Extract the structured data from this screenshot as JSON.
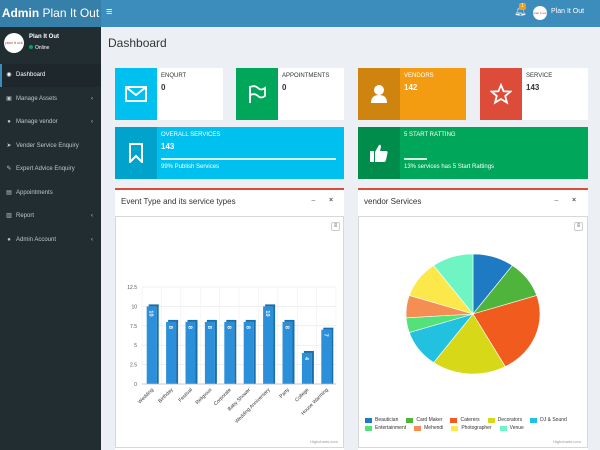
{
  "app": {
    "logo_bold": "Admin",
    "logo_rest": " Plan It Out",
    "user_name": "Plan It Out",
    "status": "Online",
    "avatar_text": "plan it out",
    "notification_count": "1"
  },
  "sidebar": {
    "items": [
      {
        "label": "Dashboard",
        "icon": "dashboard-icon",
        "glyph": "◉",
        "chevron": ""
      },
      {
        "label": "Manage Assets",
        "icon": "assets-icon",
        "glyph": "▣",
        "chevron": "‹"
      },
      {
        "label": "Manage vendor",
        "icon": "vendor-icon",
        "glyph": "●",
        "chevron": "‹"
      },
      {
        "label": "Vender Service Enquiry",
        "icon": "enquiry-icon",
        "glyph": "➤",
        "chevron": ""
      },
      {
        "label": "Expert Advice Enquiry",
        "icon": "advice-icon",
        "glyph": "✎",
        "chevron": ""
      },
      {
        "label": "Appointments",
        "icon": "appointments-icon",
        "glyph": "▤",
        "chevron": ""
      },
      {
        "label": "Report",
        "icon": "report-icon",
        "glyph": "▥",
        "chevron": "‹"
      },
      {
        "label": "Admin Account",
        "icon": "account-icon",
        "glyph": "●",
        "chevron": "‹"
      }
    ]
  },
  "page": {
    "title": "Dashboard"
  },
  "infoboxes": [
    {
      "label": "ENQURT",
      "value": "0",
      "color": "#00c0ef",
      "icon": "envelope-icon"
    },
    {
      "label": "APPOINTMENTS",
      "value": "0",
      "color": "#00a65a",
      "icon": "flag-icon"
    },
    {
      "label": "VENDORS",
      "value": "142",
      "color": "#f39c12",
      "icon": "user-icon"
    },
    {
      "label": "SERVICE",
      "value": "143",
      "color": "#dd4b39",
      "icon": "star-icon"
    }
  ],
  "progress_boxes": [
    {
      "label": "OVERALL SERVICES",
      "value": "143",
      "desc": "99% Publish Services",
      "color": "#00c0ef",
      "progress": 0.99,
      "icon": "bookmark-icon"
    },
    {
      "label": "5 START RATTING",
      "value": "",
      "desc": "13% services has 5 Start Rattings",
      "color": "#00a65a",
      "progress": 0.13,
      "icon": "thumbs-up-icon"
    }
  ],
  "boxes": {
    "event_title": "Event Type and its service types",
    "vendor_title": "vendor Services",
    "min": "−",
    "close": "×"
  },
  "credit": "Highcharts.com",
  "chart_data": [
    {
      "type": "bar",
      "categories": [
        "Wedding",
        "Birthday",
        "Festival",
        "Religious",
        "Corporate",
        "Baby Shower",
        "Wedding Anniversary",
        "Party",
        "College",
        "House Warming"
      ],
      "values": [
        10,
        8,
        8,
        8,
        8,
        8,
        10,
        8,
        4,
        7
      ],
      "ylim": [
        0,
        12.5
      ],
      "yticks": [
        "0",
        "2.5",
        "5",
        "7.5",
        "10",
        "12.5"
      ],
      "color": "#2b90d9",
      "grid": true
    },
    {
      "type": "pie",
      "categories": [
        "Beautician",
        "Card Maker",
        "Caterers",
        "Decorators",
        "DJ & Sound",
        "Entertainment",
        "Mehendi",
        "Photographer",
        "Venue"
      ],
      "values": [
        10,
        10,
        22,
        18,
        10,
        4,
        6,
        10,
        10
      ],
      "colors": [
        "#1f7ac4",
        "#4fb43b",
        "#f25b1e",
        "#d6d818",
        "#22c1e0",
        "#53e27a",
        "#f48e52",
        "#fde84b",
        "#6ff5c4"
      ],
      "legend": "bottom"
    }
  ]
}
